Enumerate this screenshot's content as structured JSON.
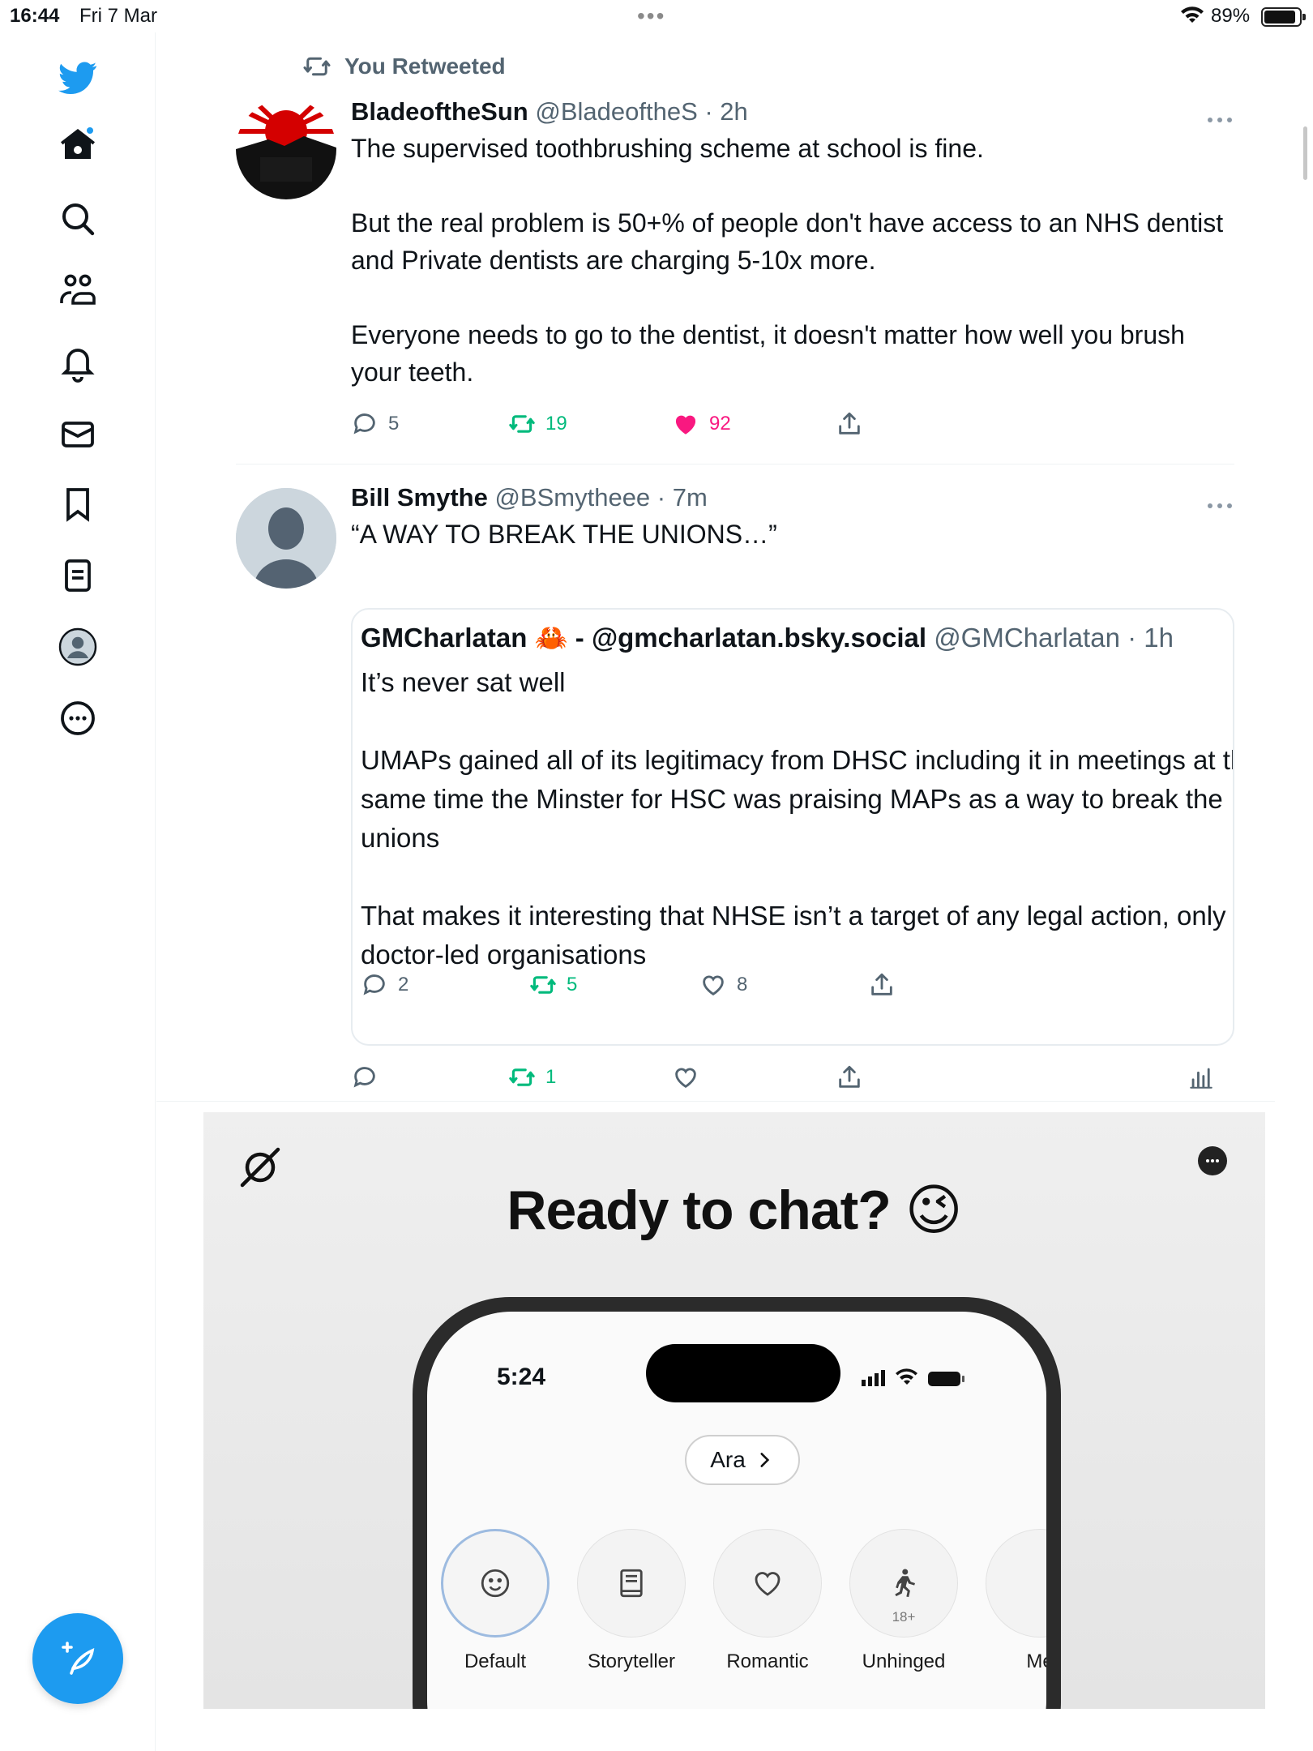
{
  "status_bar": {
    "time": "16:44",
    "date": "Fri 7 Mar",
    "battery_pct": "89%",
    "multitask_dots": "•••"
  },
  "sidebar": {
    "items": [
      {
        "name": "twitter-logo",
        "icon": "bird-icon"
      },
      {
        "name": "home",
        "icon": "home-icon",
        "badge": true
      },
      {
        "name": "search",
        "icon": "search-icon"
      },
      {
        "name": "communities",
        "icon": "people-icon"
      },
      {
        "name": "notifications",
        "icon": "bell-icon"
      },
      {
        "name": "messages",
        "icon": "envelope-icon"
      },
      {
        "name": "bookmarks",
        "icon": "bookmark-icon"
      },
      {
        "name": "lists",
        "icon": "list-icon"
      },
      {
        "name": "profile",
        "icon": "avatar-icon"
      },
      {
        "name": "more",
        "icon": "more-circle-icon"
      }
    ],
    "compose_icon": "feather-plus-icon",
    "accent_color": "#1d9bf0"
  },
  "tweets": [
    {
      "retweet_label": "You Retweeted",
      "name": "BladeoftheSun",
      "meta": "@BladeoftheS · 2h",
      "text": "The supervised toothbrushing scheme at school is fine.\n\nBut the real problem is 50+% of people don't have access to an NHS dentist and Private dentists are charging 5-10x more.\n\nEveryone needs to go to the dentist, it doesn't matter how well you brush your teeth.",
      "replies": "5",
      "retweets": "19",
      "likes": "92",
      "liked": true,
      "retweeted": true
    },
    {
      "name": "Bill Smythe",
      "meta": "@BSmytheee · 7m",
      "text": "“A WAY TO BREAK THE UNIONS…”",
      "quote": {
        "name": "GMCharlatan 🦀 - @gmcharlatan.bsky.social",
        "meta": "@GMCharlatan · 1h",
        "text": "It’s never sat well\n\nUMAPs gained all of its legitimacy from DHSC including it in meetings at the same time the Minster for HSC was praising MAPs as a way to break the unions\n\nThat makes it interesting that NHSE isn’t a target of any legal action, only doctor-led organisations",
        "replies": "2",
        "retweets": "5",
        "likes": "8"
      },
      "replies": "",
      "retweets": "1",
      "likes": ""
    }
  ],
  "ad": {
    "title": "Ready to chat? 😉",
    "phone_time": "5:24",
    "persona_pill": "Ara",
    "personas": [
      {
        "label": "Default",
        "icon": "smile-icon",
        "selected": true
      },
      {
        "label": "Storyteller",
        "icon": "book-icon"
      },
      {
        "label": "Romantic",
        "icon": "heart-icon"
      },
      {
        "label": "Unhinged",
        "icon": "running-figure-icon",
        "tag": "18+"
      },
      {
        "label": "Me",
        "icon": "unknown-icon"
      }
    ]
  },
  "colors": {
    "retweet_green": "#00ba7c",
    "like_pink": "#f91880",
    "meta_gray": "#536471"
  }
}
